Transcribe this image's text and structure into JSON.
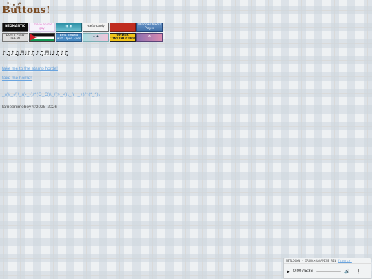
{
  "header": {
    "title": "Buttons!",
    "mascot": "ᐡ̳ᐧ ﻌ ᐧ̳ᐡ"
  },
  "badges": [
    {
      "label": "NEOMANTIC",
      "bg": "#0d0d0d",
      "fg": "#ffffff",
      "icon": "neomantic-badge-icon"
    },
    {
      "label": "i make anime gay",
      "bg": "#f6f2fb",
      "fg": "#e177c6",
      "icon": "anime-gay-badge-icon"
    },
    {
      "label": "◉ ◉",
      "bg": "#2c8fa5",
      "fg": "#d9f6ff",
      "icon": "eyes-badge-icon"
    },
    {
      "label": "melancholy",
      "bg": "#f2f2f2",
      "fg": "#111111",
      "icon": "melancholy-badge-icon"
    },
    {
      "label": "",
      "bg": "#c02c1f",
      "fg": "#ffffff",
      "icon": "red-badge-icon"
    },
    {
      "label": "Windows Media Player",
      "bg": "#3f6fa8",
      "fg": "#ffffff",
      "icon": "windows-media-player-badge-icon"
    },
    {
      "label": "DON'T FEED THE AI",
      "bg": "#dcdcdc",
      "fg": "#333333",
      "icon": "dont-feed-ai-badge-icon"
    },
    {
      "label": "",
      "bg": "#149954",
      "fg": "#ffffff",
      "icon": "palestine-flag-badge-icon"
    },
    {
      "label": "Best viewed with Open Eyes",
      "bg": "#4a8bc3",
      "fg": "#ffffff",
      "icon": "open-eyes-badge-icon"
    },
    {
      "label": "✦ ✦",
      "bg": "#a9dde0",
      "fg": "#204050",
      "icon": "sparkle-badge-icon"
    },
    {
      "label": "UNDER CONSTRUCTION",
      "bg": "#f2c318",
      "fg": "#222222",
      "icon": "under-construction-badge-icon"
    },
    {
      "label": "✿",
      "bg": "#8d6fb0",
      "fg": "#ffffff",
      "icon": "flower-badge-icon"
    }
  ],
  "stamps": "♪♫♪♫♬♩♪♫♪♫♬♩♪♫♪♫",
  "links": {
    "stamp_horde": "take me to the stamp horde!",
    "home": "take me home!"
  },
  "decoration": "_/(#_#)\\_/(-_-)/^(O_O)\\_/(>_<)\\_/(+_+)/^(*_*)\\",
  "footer": "lameanimeboy ©2025-2026",
  "player": {
    "now_playing": "METLOOWN - IROHA×KAGAMINE RIN",
    "source_label": "[source]",
    "time": "0:00 / 5:36",
    "play_icon": "play-icon",
    "volume_icon": "volume-icon",
    "menu_icon": "more-vert-icon"
  },
  "colors": {
    "link": "#6aa4de",
    "title": "#7a4a22"
  }
}
